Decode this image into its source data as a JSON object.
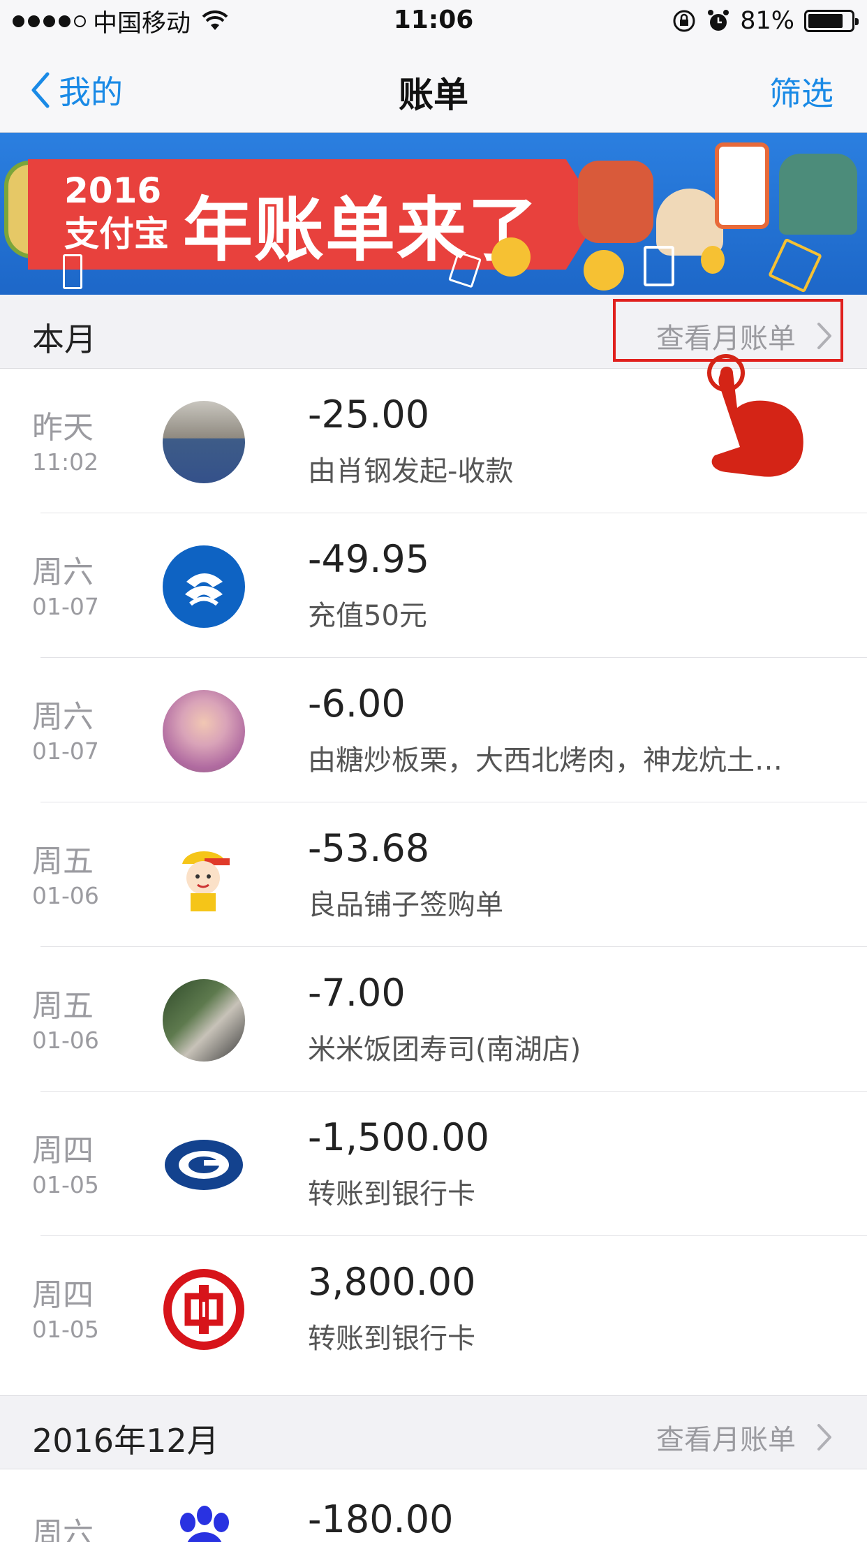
{
  "status_bar": {
    "carrier": "中国移动",
    "time": "11:06",
    "battery": "81%",
    "battery_level": 0.81,
    "icons": [
      "signal-icon",
      "wifi-icon",
      "rotation-lock-icon",
      "alarm-icon",
      "battery-icon"
    ]
  },
  "nav": {
    "back_label": "我的",
    "title": "账单",
    "filter_label": "筛选"
  },
  "banner": {
    "year_line1": "2016",
    "year_line2": "支付宝",
    "title": "年账单来了"
  },
  "sections": [
    {
      "title": "本月",
      "link": "查看月账单",
      "transactions": [
        {
          "day": "昨天",
          "date": "11:02",
          "amount": "-25.00",
          "desc": "由肖钢发起-收款",
          "avatar": "person-photo"
        },
        {
          "day": "周六",
          "date": "01-07",
          "amount": "-49.95",
          "desc": "充值50元",
          "avatar": "china-mobile-logo"
        },
        {
          "day": "周六",
          "date": "01-07",
          "amount": "-6.00",
          "desc": "由糖炒板栗，大西北烤肉，神龙炕土…",
          "avatar": "person-photo"
        },
        {
          "day": "周五",
          "date": "01-06",
          "amount": "-53.68",
          "desc": "良品铺子签购单",
          "avatar": "cartoon-mascot"
        },
        {
          "day": "周五",
          "date": "01-06",
          "amount": "-7.00",
          "desc": "米米饭团寿司(南湖店)",
          "avatar": "shop-photo"
        },
        {
          "day": "周四",
          "date": "01-05",
          "amount": "-1,500.00",
          "desc": "转账到银行卡",
          "avatar": "bank-logo-blue"
        },
        {
          "day": "周四",
          "date": "01-05",
          "amount": "3,800.00",
          "desc": "转账到银行卡",
          "avatar": "icbc-logo"
        }
      ]
    },
    {
      "title": "2016年12月",
      "link": "查看月账单",
      "transactions": [
        {
          "day": "周六",
          "date": "",
          "amount": "-180.00",
          "desc": "",
          "avatar": "paw-logo"
        }
      ]
    }
  ],
  "colors": {
    "accent": "#1a8ae6",
    "highlight": "#e0201d",
    "banner_blue": "#1d67c8",
    "banner_red": "#e8413d"
  }
}
